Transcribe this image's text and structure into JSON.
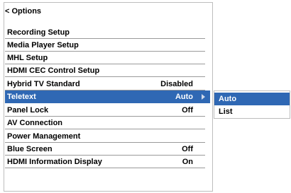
{
  "menu": {
    "title": "< Options",
    "items": [
      {
        "label": "Recording Setup",
        "value": ""
      },
      {
        "label": "Media Player Setup",
        "value": ""
      },
      {
        "label": "MHL Setup",
        "value": ""
      },
      {
        "label": "HDMI CEC Control Setup",
        "value": ""
      },
      {
        "label": "Hybrid TV Standard",
        "value": "Disabled"
      },
      {
        "label": "Teletext",
        "value": "Auto"
      },
      {
        "label": "Panel Lock",
        "value": "Off"
      },
      {
        "label": "AV Connection",
        "value": ""
      },
      {
        "label": "Power Management",
        "value": ""
      },
      {
        "label": "Blue Screen",
        "value": "Off"
      },
      {
        "label": "HDMI Information Display",
        "value": "On"
      }
    ],
    "selected_item": "Teletext"
  },
  "submenu": {
    "options": [
      {
        "label": "Auto"
      },
      {
        "label": "List"
      }
    ],
    "selected_option": "Auto"
  },
  "colors": {
    "highlight": "#2f68b4",
    "divider": "#9a9a9a",
    "panel_border": "#bdbdbd"
  },
  "icons": {
    "submenu_arrow": "triangle-right-icon"
  }
}
